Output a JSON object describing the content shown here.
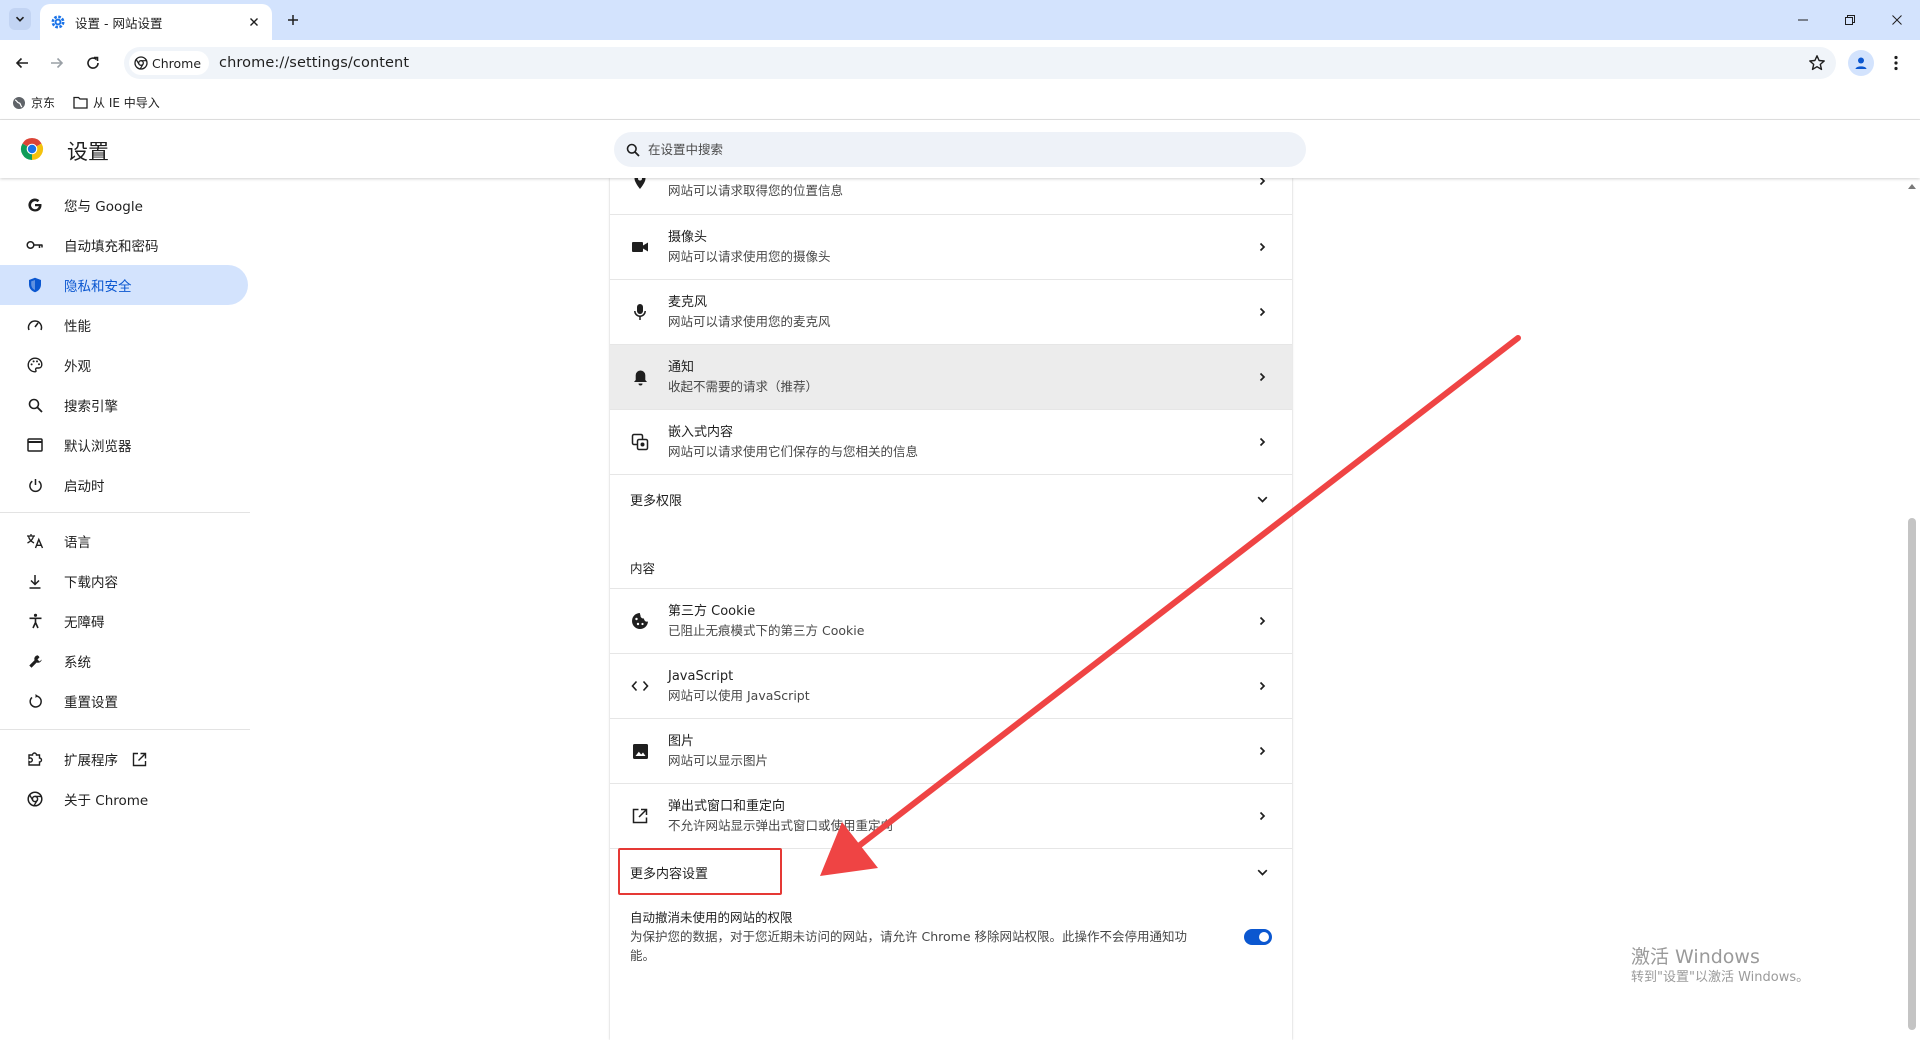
{
  "browser": {
    "tab_title": "设置 - 网站设置",
    "url_chip": "Chrome",
    "url": "chrome://settings/content",
    "bookmarks": [
      {
        "label": "京东"
      },
      {
        "label": "从 IE 中导入"
      }
    ]
  },
  "settings": {
    "title": "设置",
    "search_placeholder": "在设置中搜索"
  },
  "sidebar": {
    "items": [
      {
        "label": "您与 Google",
        "icon": "google-icon"
      },
      {
        "label": "自动填充和密码",
        "icon": "key-icon"
      },
      {
        "label": "隐私和安全",
        "icon": "shield-icon",
        "active": true
      },
      {
        "label": "性能",
        "icon": "speedometer-icon"
      },
      {
        "label": "外观",
        "icon": "palette-icon"
      },
      {
        "label": "搜索引擎",
        "icon": "search-icon"
      },
      {
        "label": "默认浏览器",
        "icon": "browser-window-icon"
      },
      {
        "label": "启动时",
        "icon": "power-icon"
      },
      {
        "label": "语言",
        "icon": "translate-icon"
      },
      {
        "label": "下载内容",
        "icon": "download-icon"
      },
      {
        "label": "无障碍",
        "icon": "accessibility-icon"
      },
      {
        "label": "系统",
        "icon": "wrench-icon"
      },
      {
        "label": "重置设置",
        "icon": "reset-icon"
      },
      {
        "label": "扩展程序",
        "icon": "puzzle-icon"
      },
      {
        "label": "关于 Chrome",
        "icon": "chrome-icon"
      }
    ]
  },
  "permissions": {
    "location_desc": "网站可以请求取得您的位置信息",
    "rows": [
      {
        "title": "摄像头",
        "desc": "网站可以请求使用您的摄像头",
        "icon": "camera-icon"
      },
      {
        "title": "麦克风",
        "desc": "网站可以请求使用您的麦克风",
        "icon": "microphone-icon"
      },
      {
        "title": "通知",
        "desc": "收起不需要的请求（推荐）",
        "icon": "bell-icon"
      },
      {
        "title": "嵌入式内容",
        "desc": "网站可以请求使用它们保存的与您相关的信息",
        "icon": "embedded-content-icon"
      }
    ],
    "more_label": "更多权限"
  },
  "content": {
    "heading": "内容",
    "rows": [
      {
        "title": "第三方 Cookie",
        "desc": "已阻止无痕模式下的第三方 Cookie",
        "icon": "cookie-icon"
      },
      {
        "title": "JavaScript",
        "desc": "网站可以使用 JavaScript",
        "icon": "code-icon"
      },
      {
        "title": "图片",
        "desc": "网站可以显示图片",
        "icon": "image-icon"
      },
      {
        "title": "弹出式窗口和重定向",
        "desc": "不允许网站显示弹出式窗口或使用重定向",
        "icon": "popup-icon"
      }
    ],
    "more_label": "更多内容设置"
  },
  "auto_revoke": {
    "title": "自动撤消未使用的网站的权限",
    "desc": "为保护您的数据，对于您近期未访问的网站，请允许 Chrome 移除网站权限。此操作不会停用通知功能。",
    "enabled": true
  },
  "watermark": {
    "line1": "激活 Windows",
    "line2": "转到\"设置\"以激活 Windows。"
  },
  "colors": {
    "accent": "#0b57d0",
    "active_bg": "#d3e3fd",
    "annotation": "#e53935"
  }
}
